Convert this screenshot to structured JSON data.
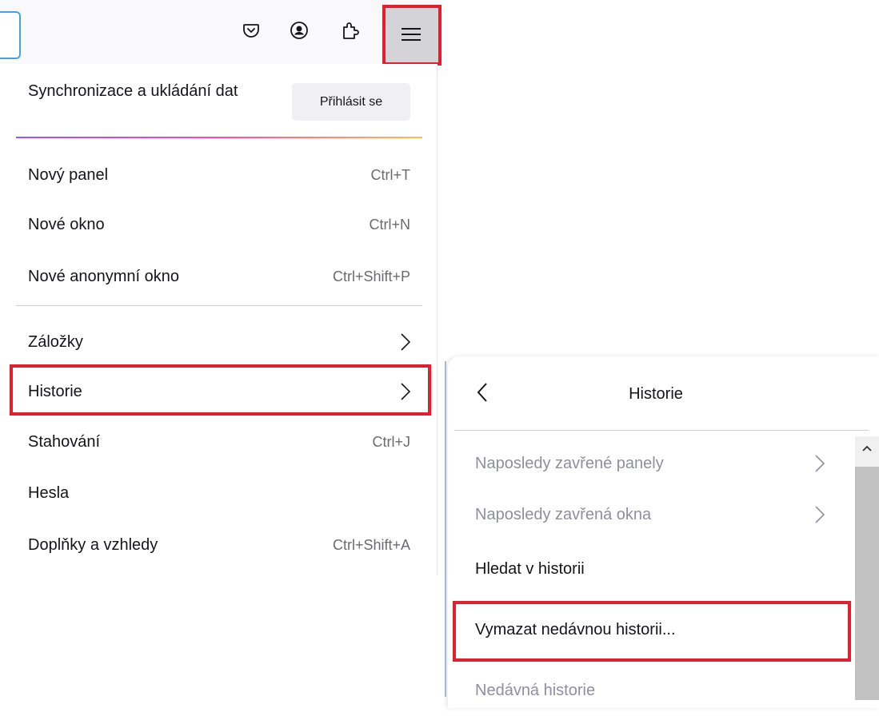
{
  "toolbar": {
    "icons": [
      "pocket-icon",
      "account-icon",
      "extensions-icon",
      "hamburger-menu-icon"
    ]
  },
  "main_menu": {
    "sync_title": "Synchronizace a ukládání dat",
    "signin_label": "Přihlásit se",
    "items": [
      {
        "label": "Nový panel",
        "shortcut": "Ctrl+T"
      },
      {
        "label": "Nové okno",
        "shortcut": "Ctrl+N"
      },
      {
        "label": "Nové anonymní okno",
        "shortcut": "Ctrl+Shift+P"
      },
      {
        "label": "Záložky",
        "shortcut": ""
      },
      {
        "label": "Historie",
        "shortcut": ""
      },
      {
        "label": "Stahování",
        "shortcut": "Ctrl+J"
      },
      {
        "label": "Hesla",
        "shortcut": ""
      },
      {
        "label": "Doplňky a vzhledy",
        "shortcut": "Ctrl+Shift+A"
      }
    ]
  },
  "history_panel": {
    "title": "Historie",
    "items": [
      {
        "label": "Naposledy zavřené panely"
      },
      {
        "label": "Naposledy zavřená okna"
      },
      {
        "label": "Hledat v historii"
      },
      {
        "label": "Vymazat nedávnou historii..."
      },
      {
        "label": "Nedávná historie"
      }
    ]
  },
  "colors": {
    "highlight": "#e0202e",
    "disabled_text": "#8f8f9d",
    "shortcut_text": "#6b6a70"
  }
}
